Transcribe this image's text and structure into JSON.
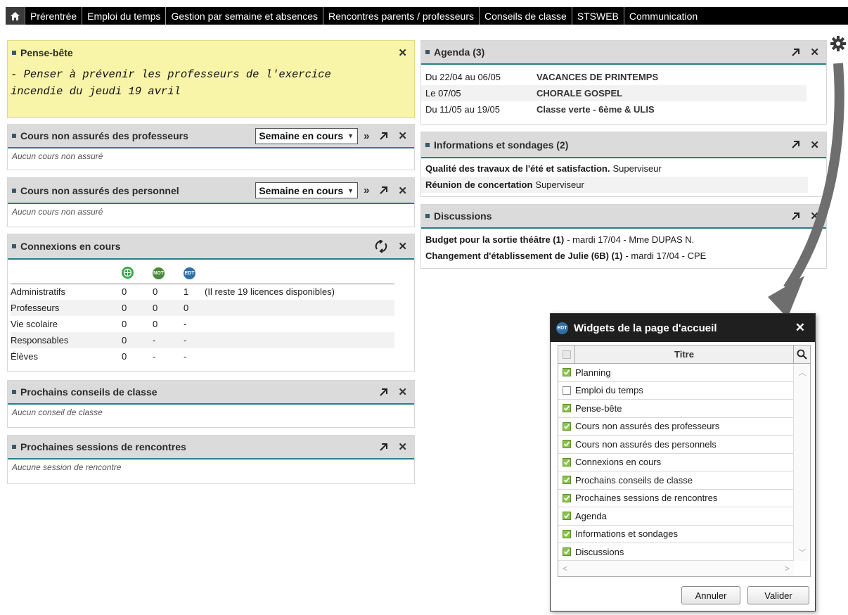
{
  "topnav": {
    "items": [
      "Prérentrée",
      "Emploi du temps",
      "Gestion par semaine et absences",
      "Rencontres parents / professeurs",
      "Conseils de classe",
      "STSWEB",
      "Communication"
    ]
  },
  "pense_bete": {
    "title": "Pense-bête",
    "line1": "- Penser à prévenir les professeurs de l'exercice",
    "line2": "incendie du jeudi 19 avril"
  },
  "cours_profs": {
    "title": "Cours non assurés des professeurs",
    "period": "Semaine en cours",
    "empty": "Aucun cours non assuré"
  },
  "cours_perso": {
    "title": "Cours non assurés des personnel",
    "period": "Semaine en cours",
    "empty": "Aucun cours non assuré"
  },
  "connexions": {
    "title": "Connexions en cours",
    "badges": [
      "🌐",
      "NOT",
      "EDT"
    ],
    "rows": [
      {
        "label": "Administratifs",
        "a": "0",
        "b": "0",
        "c": "1",
        "note": "(Il reste 19 licences disponibles)"
      },
      {
        "label": "Professeurs",
        "a": "0",
        "b": "0",
        "c": "0",
        "note": ""
      },
      {
        "label": "Vie scolaire",
        "a": "0",
        "b": "0",
        "c": "-",
        "note": ""
      },
      {
        "label": "Responsables",
        "a": "0",
        "b": "-",
        "c": "-",
        "note": ""
      },
      {
        "label": "Élèves",
        "a": "0",
        "b": "-",
        "c": "-",
        "note": ""
      }
    ]
  },
  "conseils": {
    "title": "Prochains conseils de classe",
    "empty": "Aucun conseil de classe"
  },
  "rencontres": {
    "title": "Prochaines sessions de rencontres",
    "empty": "Aucune session de rencontre"
  },
  "agenda": {
    "title": "Agenda (3)",
    "rows": [
      {
        "date": "Du 22/04 au 06/05",
        "event": "VACANCES DE PRINTEMPS"
      },
      {
        "date": "Le 07/05",
        "event": "CHORALE GOSPEL"
      },
      {
        "date": "Du 11/05 au 19/05",
        "event": "Classe verte - 6ème & ULIS"
      }
    ]
  },
  "infos": {
    "title": "Informations et sondages (2)",
    "rows": [
      {
        "subject": "Qualité des travaux de l'été et satisfaction.",
        "author": "Superviseur"
      },
      {
        "subject": "Réunion de concertation",
        "author": "Superviseur"
      }
    ]
  },
  "discussions": {
    "title": "Discussions",
    "rows": [
      {
        "subject": "Budget pour la sortie théâtre (1)",
        "meta": "- mardi 17/04 - Mme DUPAS N."
      },
      {
        "subject": "Changement d'établissement de Julie (6B) (1)",
        "meta": "- mardi 17/04 - CPE"
      }
    ]
  },
  "dialog": {
    "badge": "EDT",
    "title": "Widgets de la page d'accueil",
    "column_title": "Titre",
    "items": [
      {
        "label": "Planning",
        "checked": true
      },
      {
        "label": "Emploi du temps",
        "checked": false
      },
      {
        "label": "Pense-bête",
        "checked": true
      },
      {
        "label": "Cours non assurés des professeurs",
        "checked": true
      },
      {
        "label": "Cours non assurés des personnels",
        "checked": true
      },
      {
        "label": "Connexions en cours",
        "checked": true
      },
      {
        "label": "Prochains conseils de classe",
        "checked": true
      },
      {
        "label": "Prochaines sessions de rencontres",
        "checked": true
      },
      {
        "label": "Agenda",
        "checked": true
      },
      {
        "label": "Informations et sondages",
        "checked": true
      },
      {
        "label": "Discussions",
        "checked": true
      }
    ],
    "cancel": "Annuler",
    "ok": "Valider"
  },
  "colors": {
    "accent": "#2a7d8c",
    "panel_header": "#dbdbdb",
    "memo_bg": "#f8f4a8",
    "check_green": "#8bc34a"
  }
}
